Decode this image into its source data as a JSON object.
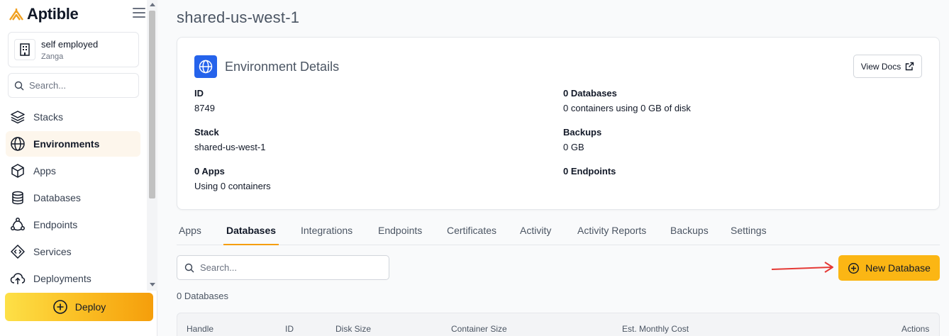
{
  "sidebar": {
    "logo_text": "Aptible",
    "org": {
      "name": "self employed",
      "sub": "Zanga"
    },
    "search_placeholder": "Search...",
    "items": [
      {
        "label": "Stacks",
        "icon": "layers-icon"
      },
      {
        "label": "Environments",
        "icon": "globe-icon",
        "active": true
      },
      {
        "label": "Apps",
        "icon": "cube-icon"
      },
      {
        "label": "Databases",
        "icon": "database-icon"
      },
      {
        "label": "Endpoints",
        "icon": "network-icon"
      },
      {
        "label": "Services",
        "icon": "code-diamond-icon"
      },
      {
        "label": "Deployments",
        "icon": "cloud-upload-icon"
      }
    ],
    "deploy_label": "Deploy"
  },
  "page": {
    "title": "shared-us-west-1"
  },
  "env_card": {
    "heading": "Environment Details",
    "view_docs_label": "View Docs",
    "left": [
      {
        "label": "ID",
        "value": "8749"
      },
      {
        "label": "Stack",
        "value": "shared-us-west-1"
      },
      {
        "label": "0 Apps",
        "value": "Using 0 containers"
      }
    ],
    "right": [
      {
        "label": "0 Databases",
        "value": "0 containers using 0 GB of disk"
      },
      {
        "label": "Backups",
        "value": "0 GB"
      },
      {
        "label": "0 Endpoints",
        "value": ""
      }
    ]
  },
  "tabs": [
    {
      "label": "Apps"
    },
    {
      "label": "Databases",
      "active": true
    },
    {
      "label": "Integrations"
    },
    {
      "label": "Endpoints"
    },
    {
      "label": "Certificates"
    },
    {
      "label": "Activity"
    },
    {
      "label": "Activity Reports"
    },
    {
      "label": "Backups"
    },
    {
      "label": "Settings"
    }
  ],
  "databases": {
    "search_placeholder": "Search...",
    "new_button_label": "New Database",
    "count_text": "0 Databases",
    "columns": [
      "Handle",
      "ID",
      "Disk Size",
      "Container Size",
      "Est. Monthly Cost",
      "Actions"
    ]
  },
  "colors": {
    "accent": "#fbb614",
    "brand_blue": "#2563eb",
    "annotation_arrow": "#e53935"
  }
}
